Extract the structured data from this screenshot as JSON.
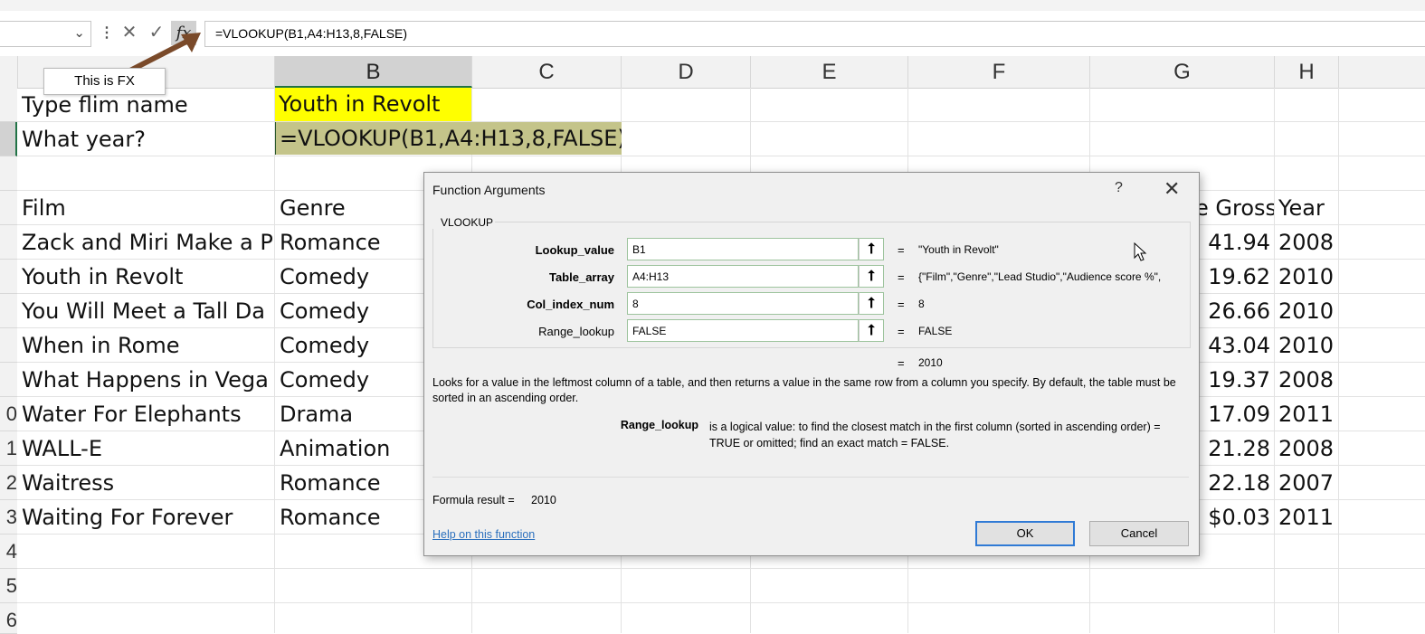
{
  "formula_bar": {
    "name_box": "",
    "cancel_icon": "✕",
    "enter_icon": "✓",
    "fx_label": "fx",
    "formula": "=VLOOKUP(B1,A4:H13,8,FALSE)"
  },
  "tooltip": {
    "text": "This is FX"
  },
  "columns": [
    "B",
    "C",
    "D",
    "E",
    "F",
    "G",
    "H"
  ],
  "row_numbers": [
    "0",
    "1",
    "2",
    "3",
    "4",
    "5",
    "6"
  ],
  "cells": {
    "a1": "Type flim name",
    "b1": "Youth in Revolt",
    "a2": "What year?",
    "b2": "=VLOOKUP(B1,A4:H13,8,FALSE)"
  },
  "table": {
    "headers": {
      "film": "Film",
      "genre": "Genre",
      "gross": "e Gross",
      "year": "Year"
    },
    "rows": [
      {
        "film": "Zack and Miri Make a P",
        "genre": "Romance",
        "gross": "41.94",
        "year": "2008"
      },
      {
        "film": "Youth in Revolt",
        "genre": "Comedy",
        "gross": "19.62",
        "year": "2010"
      },
      {
        "film": "You Will Meet a Tall Da",
        "genre": "Comedy",
        "gross": "26.66",
        "year": "2010"
      },
      {
        "film": "When in Rome",
        "genre": "Comedy",
        "gross": "43.04",
        "year": "2010"
      },
      {
        "film": "What Happens in Vega",
        "genre": "Comedy",
        "gross": "19.37",
        "year": "2008"
      },
      {
        "film": "Water For Elephants",
        "genre": "Drama",
        "gross": "17.09",
        "year": "2011"
      },
      {
        "film": "WALL-E",
        "genre": "Animation",
        "gross": "21.28",
        "year": "2008"
      },
      {
        "film": "Waitress",
        "genre": "Romance",
        "gross": "22.18",
        "year": "2007"
      },
      {
        "film": "Waiting For Forever",
        "genre": "Romance",
        "gross": "$0.03",
        "year": "2011"
      }
    ]
  },
  "dialog": {
    "title": "Function Arguments",
    "help_glyph": "?",
    "close_glyph": "✕",
    "function_name": "VLOOKUP",
    "args": [
      {
        "label": "Lookup_value",
        "bold": true,
        "value": "B1",
        "result": "\"Youth in Revolt\""
      },
      {
        "label": "Table_array",
        "bold": true,
        "value": "A4:H13",
        "result": "{\"Film\",\"Genre\",\"Lead Studio\",\"Audience score %\","
      },
      {
        "label": "Col_index_num",
        "bold": true,
        "value": "8",
        "result": "8"
      },
      {
        "label": "Range_lookup",
        "bold": false,
        "value": "FALSE",
        "result": "FALSE"
      }
    ],
    "equals": "=",
    "overall_result": "2010",
    "description": "Looks for a value in the leftmost column of a table, and then returns a value in the same row from a column you specify. By default, the table must be sorted in an ascending order.",
    "arg_help_name": "Range_lookup",
    "arg_help_text": "is a logical value: to find the closest match in the first column (sorted in ascending order) = TRUE or omitted; find an exact match = FALSE.",
    "formula_result_label": "Formula result =",
    "formula_result_value": "2010",
    "help_link": "Help on this function",
    "ok_label": "OK",
    "cancel_label": "Cancel"
  },
  "colors": {
    "yellow_fill": "#ffff00",
    "formula_cell_fill": "#c4c48a",
    "selected_header": "#d2d2d2",
    "excel_green": "#217346",
    "link_blue": "#2a6fbd",
    "tooltip_arrow": "#7a4a2a"
  }
}
